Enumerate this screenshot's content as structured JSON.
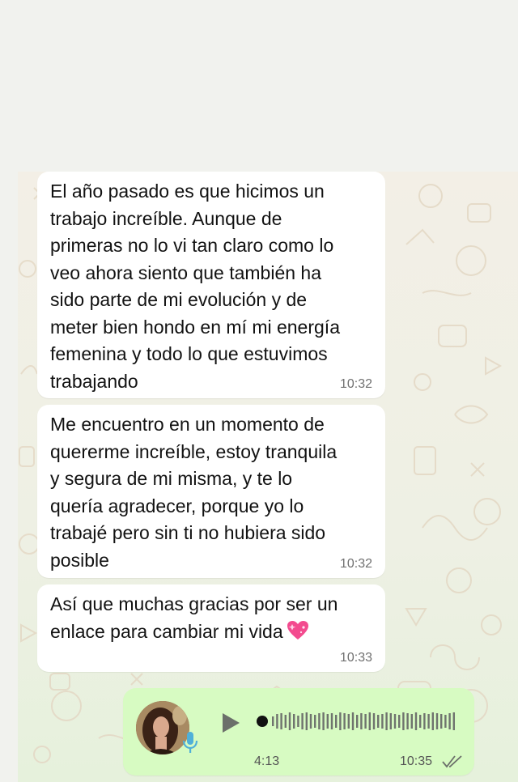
{
  "messages": [
    {
      "text": "El año pasado es que hicimos un\ntrabajo increíble. Aunque de\nprimeras no lo vi tan claro como lo\nveo ahora siento que también ha\nsido parte de mi evolución y de\nmeter bien hondo en mí mi energía\nfemenina y todo lo que estuvimos\ntrabajando",
      "time": "10:32"
    },
    {
      "text": "Me encuentro en un momento de\nquererme increíble, estoy tranquila\ny segura de mi misma, y te lo\nquería agradecer, porque yo lo\ntrabajé pero sin ti no hubiera sido\nposible",
      "time": "10:32"
    },
    {
      "text": "Así que muchas gracias por ser un\nenlace para cambiar mi vida",
      "emoji": "💖",
      "time": "10:33"
    }
  ],
  "voice_note": {
    "duration": "4:13",
    "time": "10:35",
    "status_icon": "double-check-icon",
    "play_icon": "play-icon",
    "mic_icon": "microphone-icon",
    "accent_color": "#d7fbc2"
  },
  "colors": {
    "incoming_bubble": "#ffffff",
    "outgoing_bubble": "#d7fbc2",
    "timestamp": "#707070",
    "mic_blue": "#4fb0d8"
  }
}
